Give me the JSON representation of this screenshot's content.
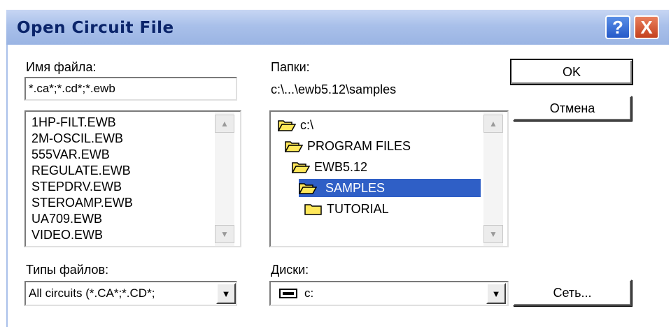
{
  "dialog": {
    "title": "Open Circuit File",
    "help_symbol": "?",
    "close_symbol": "X"
  },
  "filename": {
    "label": "Имя файла:",
    "value": "*.ca*;*.cd*;*.ewb"
  },
  "files": [
    "1HP-FILT.EWB",
    "2M-OSCIL.EWB",
    "555VAR.EWB",
    "REGULATE.EWB",
    "STEPDRV.EWB",
    "STEROAMP.EWB",
    "UA709.EWB",
    "VIDEO.EWB"
  ],
  "folders": {
    "label": "Папки:",
    "path": "c:\\...\\ewb5.12\\samples",
    "tree": [
      {
        "name": "c:\\",
        "state": "open",
        "selected": false
      },
      {
        "name": "PROGRAM FILES",
        "state": "open",
        "selected": false
      },
      {
        "name": "EWB5.12",
        "state": "open",
        "selected": false
      },
      {
        "name": "SAMPLES",
        "state": "open",
        "selected": true
      },
      {
        "name": "TUTORIAL",
        "state": "closed",
        "selected": false
      }
    ]
  },
  "buttons": {
    "ok": "OK",
    "cancel": "Отмена",
    "network": "Сеть..."
  },
  "filetypes": {
    "label": "Типы файлов:",
    "value": "All circuits (*.CA*;*.CD*;"
  },
  "drives": {
    "label": "Диски:",
    "value": "c:"
  },
  "colors": {
    "title_text": "#0a246a",
    "selection": "#2f5fc6",
    "folder_yellow": "#ffe85a"
  }
}
